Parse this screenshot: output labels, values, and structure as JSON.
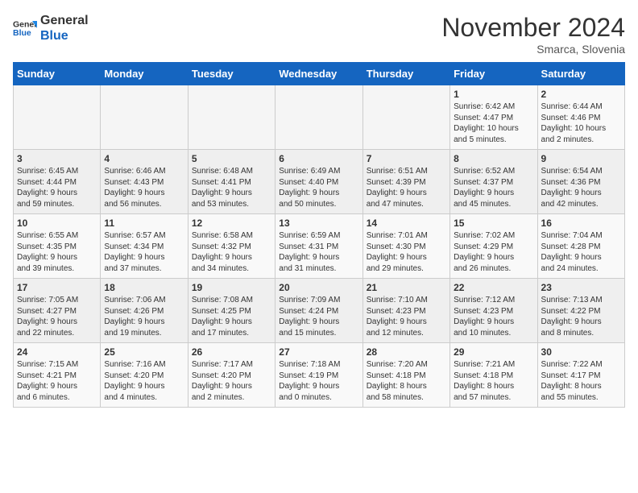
{
  "header": {
    "logo_line1": "General",
    "logo_line2": "Blue",
    "month": "November 2024",
    "location": "Smarca, Slovenia"
  },
  "weekdays": [
    "Sunday",
    "Monday",
    "Tuesday",
    "Wednesday",
    "Thursday",
    "Friday",
    "Saturday"
  ],
  "weeks": [
    [
      {
        "day": "",
        "content": ""
      },
      {
        "day": "",
        "content": ""
      },
      {
        "day": "",
        "content": ""
      },
      {
        "day": "",
        "content": ""
      },
      {
        "day": "",
        "content": ""
      },
      {
        "day": "1",
        "content": "Sunrise: 6:42 AM\nSunset: 4:47 PM\nDaylight: 10 hours\nand 5 minutes."
      },
      {
        "day": "2",
        "content": "Sunrise: 6:44 AM\nSunset: 4:46 PM\nDaylight: 10 hours\nand 2 minutes."
      }
    ],
    [
      {
        "day": "3",
        "content": "Sunrise: 6:45 AM\nSunset: 4:44 PM\nDaylight: 9 hours\nand 59 minutes."
      },
      {
        "day": "4",
        "content": "Sunrise: 6:46 AM\nSunset: 4:43 PM\nDaylight: 9 hours\nand 56 minutes."
      },
      {
        "day": "5",
        "content": "Sunrise: 6:48 AM\nSunset: 4:41 PM\nDaylight: 9 hours\nand 53 minutes."
      },
      {
        "day": "6",
        "content": "Sunrise: 6:49 AM\nSunset: 4:40 PM\nDaylight: 9 hours\nand 50 minutes."
      },
      {
        "day": "7",
        "content": "Sunrise: 6:51 AM\nSunset: 4:39 PM\nDaylight: 9 hours\nand 47 minutes."
      },
      {
        "day": "8",
        "content": "Sunrise: 6:52 AM\nSunset: 4:37 PM\nDaylight: 9 hours\nand 45 minutes."
      },
      {
        "day": "9",
        "content": "Sunrise: 6:54 AM\nSunset: 4:36 PM\nDaylight: 9 hours\nand 42 minutes."
      }
    ],
    [
      {
        "day": "10",
        "content": "Sunrise: 6:55 AM\nSunset: 4:35 PM\nDaylight: 9 hours\nand 39 minutes."
      },
      {
        "day": "11",
        "content": "Sunrise: 6:57 AM\nSunset: 4:34 PM\nDaylight: 9 hours\nand 37 minutes."
      },
      {
        "day": "12",
        "content": "Sunrise: 6:58 AM\nSunset: 4:32 PM\nDaylight: 9 hours\nand 34 minutes."
      },
      {
        "day": "13",
        "content": "Sunrise: 6:59 AM\nSunset: 4:31 PM\nDaylight: 9 hours\nand 31 minutes."
      },
      {
        "day": "14",
        "content": "Sunrise: 7:01 AM\nSunset: 4:30 PM\nDaylight: 9 hours\nand 29 minutes."
      },
      {
        "day": "15",
        "content": "Sunrise: 7:02 AM\nSunset: 4:29 PM\nDaylight: 9 hours\nand 26 minutes."
      },
      {
        "day": "16",
        "content": "Sunrise: 7:04 AM\nSunset: 4:28 PM\nDaylight: 9 hours\nand 24 minutes."
      }
    ],
    [
      {
        "day": "17",
        "content": "Sunrise: 7:05 AM\nSunset: 4:27 PM\nDaylight: 9 hours\nand 22 minutes."
      },
      {
        "day": "18",
        "content": "Sunrise: 7:06 AM\nSunset: 4:26 PM\nDaylight: 9 hours\nand 19 minutes."
      },
      {
        "day": "19",
        "content": "Sunrise: 7:08 AM\nSunset: 4:25 PM\nDaylight: 9 hours\nand 17 minutes."
      },
      {
        "day": "20",
        "content": "Sunrise: 7:09 AM\nSunset: 4:24 PM\nDaylight: 9 hours\nand 15 minutes."
      },
      {
        "day": "21",
        "content": "Sunrise: 7:10 AM\nSunset: 4:23 PM\nDaylight: 9 hours\nand 12 minutes."
      },
      {
        "day": "22",
        "content": "Sunrise: 7:12 AM\nSunset: 4:23 PM\nDaylight: 9 hours\nand 10 minutes."
      },
      {
        "day": "23",
        "content": "Sunrise: 7:13 AM\nSunset: 4:22 PM\nDaylight: 9 hours\nand 8 minutes."
      }
    ],
    [
      {
        "day": "24",
        "content": "Sunrise: 7:15 AM\nSunset: 4:21 PM\nDaylight: 9 hours\nand 6 minutes."
      },
      {
        "day": "25",
        "content": "Sunrise: 7:16 AM\nSunset: 4:20 PM\nDaylight: 9 hours\nand 4 minutes."
      },
      {
        "day": "26",
        "content": "Sunrise: 7:17 AM\nSunset: 4:20 PM\nDaylight: 9 hours\nand 2 minutes."
      },
      {
        "day": "27",
        "content": "Sunrise: 7:18 AM\nSunset: 4:19 PM\nDaylight: 9 hours\nand 0 minutes."
      },
      {
        "day": "28",
        "content": "Sunrise: 7:20 AM\nSunset: 4:18 PM\nDaylight: 8 hours\nand 58 minutes."
      },
      {
        "day": "29",
        "content": "Sunrise: 7:21 AM\nSunset: 4:18 PM\nDaylight: 8 hours\nand 57 minutes."
      },
      {
        "day": "30",
        "content": "Sunrise: 7:22 AM\nSunset: 4:17 PM\nDaylight: 8 hours\nand 55 minutes."
      }
    ]
  ]
}
